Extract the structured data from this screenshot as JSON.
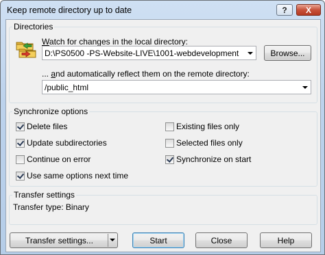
{
  "window": {
    "title": "Keep remote directory up to date",
    "help_glyph": "?",
    "close_glyph": "X"
  },
  "directories": {
    "group_title": "Directories",
    "local_label_prefix": "W",
    "local_label_rest": "atch for changes in the local directory:",
    "local_path": "D:\\PS0500 -PS-Website-LIVE\\1001-webdevelopment",
    "browse_label": "Browse...",
    "remote_label_prefix": "... ",
    "remote_label_u": "a",
    "remote_label_rest": "nd automatically reflect them on the remote directory:",
    "remote_path": "/public_html",
    "icon": "sync-folders-icon"
  },
  "sync_options": {
    "group_title": "Synchronize options",
    "options": [
      {
        "label": "Delete files",
        "checked": true
      },
      {
        "label": "Update subdirectories",
        "checked": true
      },
      {
        "label": "Continue on error",
        "checked": false
      },
      {
        "label": "Use same options next time",
        "checked": true
      },
      {
        "label": "Existing files only",
        "checked": false
      },
      {
        "label": "Selected files only",
        "checked": false
      },
      {
        "label": "Synchronize on start",
        "checked": true
      }
    ]
  },
  "transfer": {
    "group_title": "Transfer settings",
    "type_text": "Transfer type: Binary"
  },
  "buttons": {
    "transfer_settings": "Transfer settings...",
    "start": "Start",
    "close": "Close",
    "help": "Help"
  }
}
